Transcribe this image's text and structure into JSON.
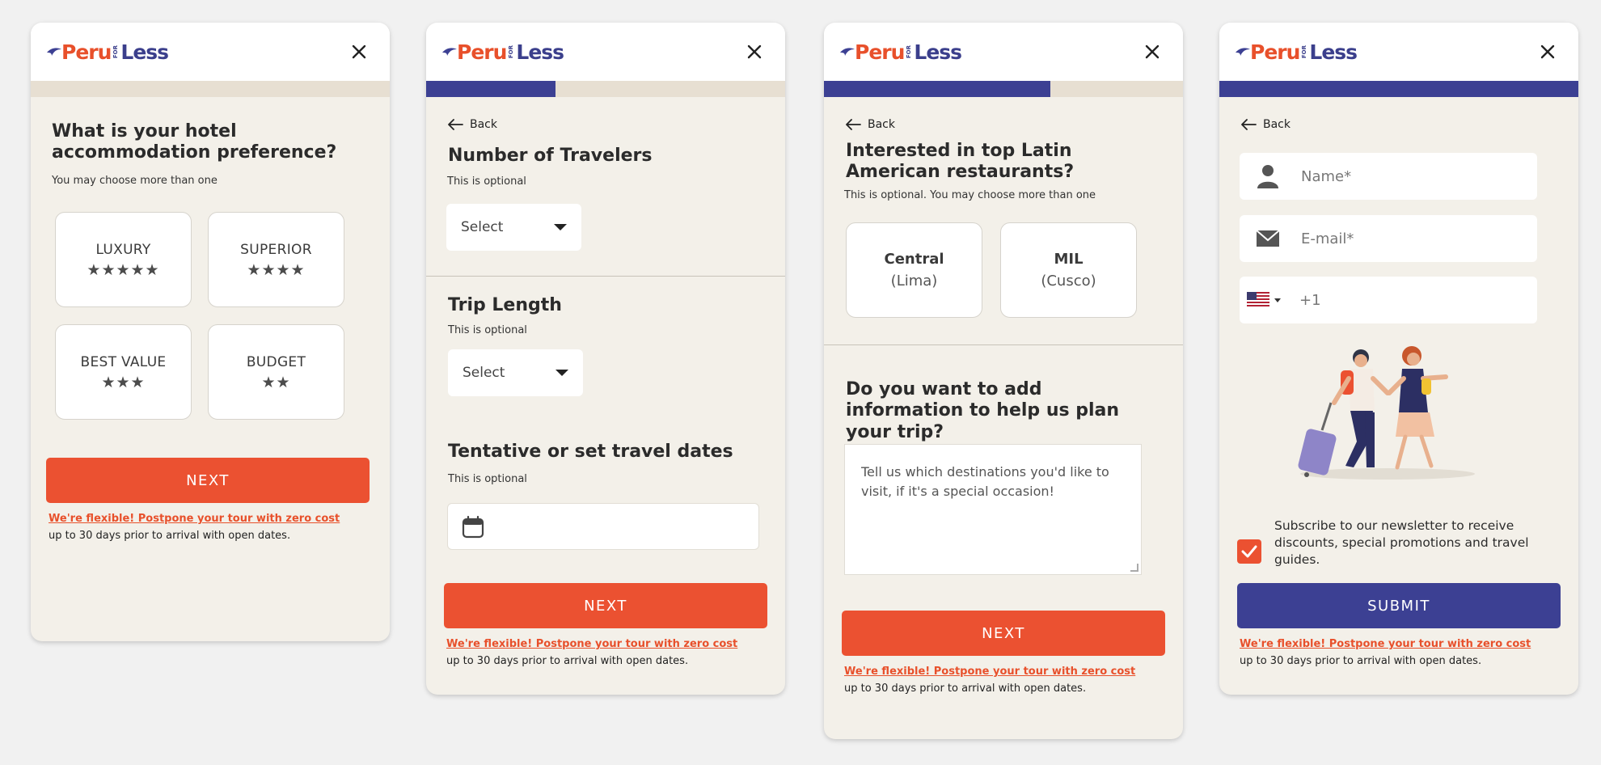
{
  "brand": {
    "peru": "Peru",
    "for": "FOR",
    "less": "Less"
  },
  "colors": {
    "orange": "#eb5131",
    "navy": "#3c4093",
    "card_bg": "#f3f0e9"
  },
  "common": {
    "close_icon": "close-icon",
    "back_label": "Back",
    "flex_link": "We're flexible! Postpone your tour with zero cost",
    "flex_note": "up to 30 days prior to arrival with open dates."
  },
  "step1": {
    "progress": 0,
    "title": "What is your hotel accommodation preference?",
    "subtitle": "You may choose more than one",
    "options": [
      {
        "label": "LUXURY",
        "stars": "★★★★★"
      },
      {
        "label": "SUPERIOR",
        "stars": "★★★★"
      },
      {
        "label": "BEST VALUE",
        "stars": "★★★"
      },
      {
        "label": "BUDGET",
        "stars": "★★"
      }
    ],
    "next_label": "NEXT"
  },
  "step2": {
    "progress": 0.36,
    "travelers": {
      "title": "Number of Travelers",
      "subtitle": "This is optional",
      "select": "Select"
    },
    "trip_length": {
      "title": "Trip Length",
      "subtitle": "This is optional",
      "select": "Select"
    },
    "dates": {
      "title": "Tentative or set travel dates",
      "subtitle": "This is optional",
      "value": ""
    },
    "next_label": "NEXT"
  },
  "step3": {
    "progress": 0.63,
    "title": "Interested in top Latin American restaurants?",
    "subtitle": "This is optional. You may choose more than one",
    "options": [
      {
        "name": "Central",
        "city": "(Lima)"
      },
      {
        "name": "MIL",
        "city": "(Cusco)"
      }
    ],
    "info_title": "Do you want to add information to help us plan your trip?",
    "textarea_placeholder": "Tell us which destinations you'd like to visit, if it's a special occasion!",
    "next_label": "NEXT"
  },
  "step4": {
    "progress": 1,
    "name_placeholder": "Name*",
    "email_placeholder": "E-mail*",
    "phone_prefix": "+1",
    "newsletter_checked": true,
    "newsletter_text": "Subscribe to our newsletter to receive discounts, special promotions and travel guides.",
    "submit_label": "SUBMIT"
  }
}
